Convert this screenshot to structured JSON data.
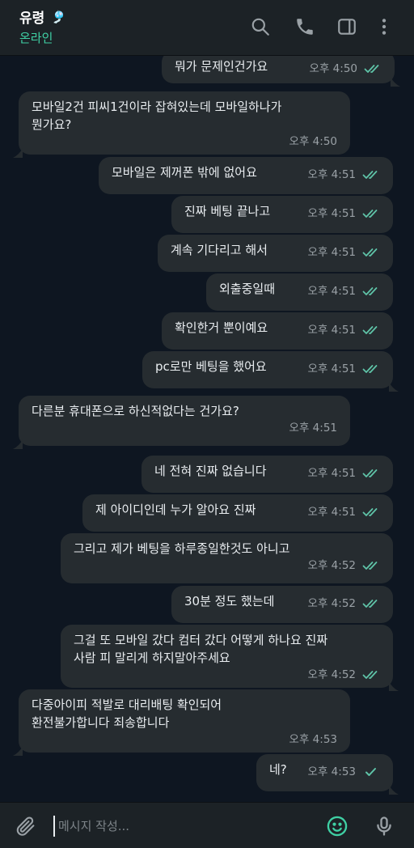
{
  "header": {
    "contact_name": "유령",
    "name_emoji": "🎐",
    "status": "온라인"
  },
  "icons": {
    "search": "search-icon",
    "call": "phone-icon",
    "panel": "sidebar-toggle-icon",
    "menu": "more-vert-icon",
    "attach": "paperclip-icon",
    "emoji": "emoji-icon",
    "mic": "microphone-icon"
  },
  "messages": [
    {
      "dir": "out",
      "text": "뭐가 문제인건가요",
      "time": "오후 4:50",
      "ticks": "double"
    },
    {
      "dir": "in",
      "text": "모바일2건 피씨1건이라 잡혀있는데 모바일하나가\n뭔가요?",
      "time": "오후 4:50"
    },
    {
      "dir": "out",
      "text": "모바일은 제꺼폰 밖에 없어요",
      "time": "오후 4:51",
      "ticks": "double"
    },
    {
      "dir": "out",
      "text": "진짜 베팅 끝나고",
      "time": "오후 4:51",
      "ticks": "double"
    },
    {
      "dir": "out",
      "text": "계속 기다리고 해서",
      "time": "오후 4:51",
      "ticks": "double"
    },
    {
      "dir": "out",
      "text": "외출중일때",
      "time": "오후 4:51",
      "ticks": "double"
    },
    {
      "dir": "out",
      "text": "확인한거 뿐이예요",
      "time": "오후 4:51",
      "ticks": "double"
    },
    {
      "dir": "out",
      "text": "pc로만 베팅을 했어요",
      "time": "오후 4:51",
      "ticks": "double"
    },
    {
      "dir": "in",
      "text": "다른분 휴대폰으로 하신적없다는 건가요?",
      "time": "오후 4:51"
    },
    {
      "dir": "out",
      "text": "네 전혀 진짜 없습니다",
      "time": "오후 4:51",
      "ticks": "double"
    },
    {
      "dir": "out",
      "text": "제 아이디인데 누가 알아요 진짜",
      "time": "오후 4:51",
      "ticks": "double"
    },
    {
      "dir": "out",
      "text": "그리고 제가 베팅을 하루종일한것도 아니고",
      "time": "오후 4:52",
      "ticks": "double"
    },
    {
      "dir": "out",
      "text": "30분 정도 했는데",
      "time": "오후 4:52",
      "ticks": "double"
    },
    {
      "dir": "out",
      "text": "그걸 또 모바일 갔다 컴터 갔다 어떻게 하나요 진짜\n사람 피 말리게 하지말아주세요",
      "time": "오후 4:52",
      "ticks": "double"
    },
    {
      "dir": "in",
      "text": "다중아이피 적발로 대리배팅 확인되어\n환전불가합니다 죄송합니다",
      "time": "오후 4:53"
    },
    {
      "dir": "out",
      "text": "네?",
      "time": "오후 4:53",
      "ticks": "single"
    }
  ],
  "composer": {
    "placeholder": "메시지 작성..."
  },
  "colors": {
    "background": "#0e1621",
    "header": "#1c2226",
    "bubble": "#262c30",
    "accent": "#3fd0a4",
    "ticks": "#5fc4a8"
  }
}
